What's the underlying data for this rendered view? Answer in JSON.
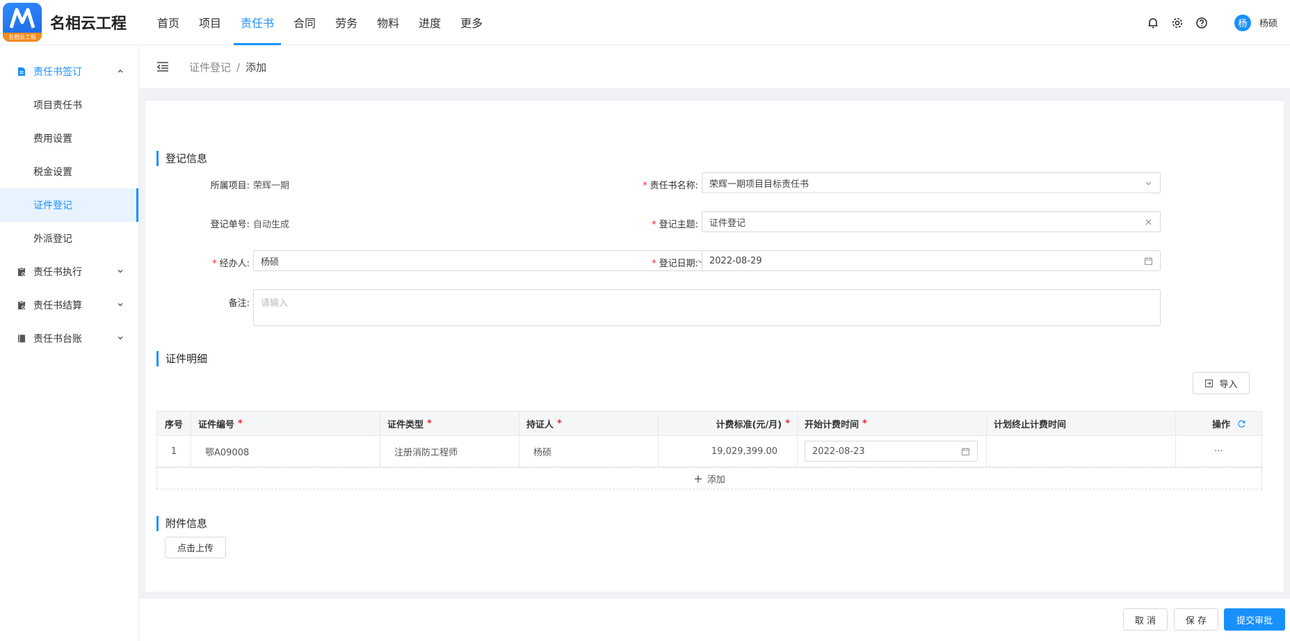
{
  "brand": {
    "name": "名相云工程",
    "logo_text": "名相云工程"
  },
  "nav": {
    "items": [
      "首页",
      "项目",
      "责任书",
      "合同",
      "劳务",
      "物料",
      "进度",
      "更多"
    ],
    "active_index": 2
  },
  "user": {
    "avatar_char": "杨",
    "name": "杨硕"
  },
  "sidebar": {
    "group_open": "责任书签订",
    "sub_items": [
      "项目责任书",
      "费用设置",
      "税金设置",
      "证件登记",
      "外派登记"
    ],
    "active_sub": "证件登记",
    "groups_closed": [
      "责任书执行",
      "责任书结算",
      "责任书台账"
    ]
  },
  "breadcrumb": {
    "parent": "证件登记",
    "separator": "/",
    "current": "添加"
  },
  "section_register": {
    "title": "登记信息",
    "project_label": "所属项目:",
    "project_value": "荣辉一期",
    "doc_no_label": "登记单号:",
    "doc_no_value": "自动生成",
    "handler_label": "经办人:",
    "handler_value": "杨硕",
    "note_label": "备注:",
    "note_placeholder": "请输入",
    "book_label": "责任书名称:",
    "book_value": "荣辉一期项目目标责任书",
    "subject_label": "登记主题:",
    "subject_value": "证件登记",
    "date_label": "登记日期:",
    "date_value": "2022-08-29"
  },
  "section_detail": {
    "title": "证件明细",
    "import_label": "导入",
    "columns": {
      "seq": "序号",
      "cert_no": "证件编号",
      "cert_type": "证件类型",
      "holder": "持证人",
      "rate": "计费标准(元/月)",
      "start": "开始计费时间",
      "end": "计划终止计费时间",
      "op": "操作"
    },
    "rows": [
      {
        "seq": "1",
        "cert_no": "鄂A09008",
        "cert_type": "注册消防工程师",
        "holder": "杨硕",
        "rate": "19,029,399.00",
        "start": "2022-08-23",
        "end": "",
        "op": "···"
      }
    ],
    "add_label": "添加"
  },
  "section_attach": {
    "title": "附件信息",
    "upload_label": "点击上传"
  },
  "footer": {
    "cancel": "取 消",
    "save": "保 存",
    "submit": "提交审批"
  },
  "colors": {
    "primary": "#1890ff",
    "required": "#f5222d",
    "accent_logo": "#f48a1e"
  }
}
